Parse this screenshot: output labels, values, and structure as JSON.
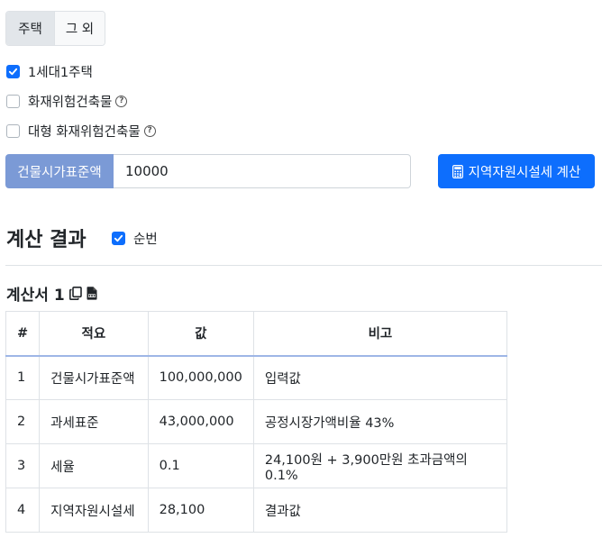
{
  "tabs": [
    {
      "label": "주택",
      "active": true
    },
    {
      "label": "그 외",
      "active": false
    }
  ],
  "options": [
    {
      "label": "1세대1주택",
      "checked": true,
      "help": false
    },
    {
      "label": "화재위험건축물",
      "checked": false,
      "help": true
    },
    {
      "label": "대형 화재위험건축물",
      "checked": false,
      "help": true
    }
  ],
  "help_glyph": "?",
  "input": {
    "label": "건물시가표준액",
    "value": "10000"
  },
  "calc_button": {
    "label": "지역자원시설세 계산",
    "icon": "calculator-icon"
  },
  "result": {
    "title": "계산 결과",
    "sunbeon_label": "순번",
    "sunbeon_checked": true
  },
  "document": {
    "title": "계산서 1",
    "icons": [
      "copy-icon",
      "csv-file-icon"
    ]
  },
  "table": {
    "headers": [
      "#",
      "적요",
      "값",
      "비고"
    ],
    "rows": [
      [
        "1",
        "건물시가표준액",
        "100,000,000",
        "입력값"
      ],
      [
        "2",
        "과세표준",
        "43,000,000",
        "공정시장가액비율 43%"
      ],
      [
        "3",
        "세율",
        "0.1",
        "24,100원 + 3,900만원 초과금액의 0.1%"
      ],
      [
        "4",
        "지역자원시설세",
        "28,100",
        "결과값"
      ]
    ]
  },
  "colors": {
    "primary": "#0d6efd",
    "label_bg": "#7b9ad6",
    "border": "#dee2e6"
  }
}
